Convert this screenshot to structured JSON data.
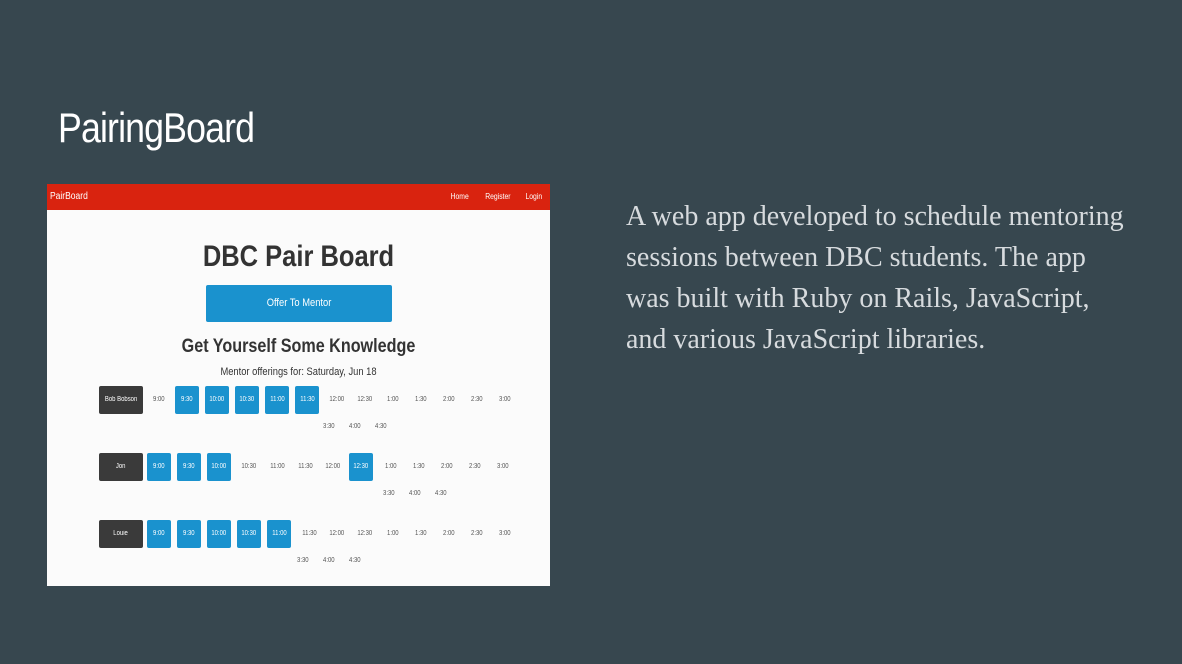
{
  "slide": {
    "title": "PairingBoard",
    "description": "A web app developed to schedule mentoring sessions between DBC students. The app was built with Ruby on Rails, JavaScript, and various JavaScript libraries."
  },
  "app": {
    "brand": "PairBoard",
    "nav": [
      "Home",
      "Register",
      "Login"
    ],
    "title": "DBC Pair Board",
    "offer_button": "Offer To Mentor",
    "subheading": "Get Yourself Some Knowledge",
    "date_line": "Mentor offerings for: Saturday, Jun 18",
    "mentors": [
      {
        "name": "Bob Bobson",
        "slots": [
          {
            "t": "9:00",
            "on": false
          },
          {
            "t": "9:30",
            "on": true
          },
          {
            "t": "10:00",
            "on": true
          },
          {
            "t": "10:30",
            "on": true
          },
          {
            "t": "11:00",
            "on": true
          },
          {
            "t": "11:30",
            "on": true
          },
          {
            "t": "12:00",
            "on": false
          },
          {
            "t": "12:30",
            "on": false
          },
          {
            "t": "1:00",
            "on": false
          },
          {
            "t": "1:30",
            "on": false
          },
          {
            "t": "2:00",
            "on": false
          },
          {
            "t": "2:30",
            "on": false
          },
          {
            "t": "3:00",
            "on": false
          },
          {
            "t": "3:30",
            "on": false
          },
          {
            "t": "4:00",
            "on": false
          },
          {
            "t": "4:30",
            "on": false
          }
        ]
      },
      {
        "name": "Jon",
        "slots": [
          {
            "t": "9:00",
            "on": true
          },
          {
            "t": "9:30",
            "on": true
          },
          {
            "t": "10:00",
            "on": true
          },
          {
            "t": "10:30",
            "on": false
          },
          {
            "t": "11:00",
            "on": false
          },
          {
            "t": "11:30",
            "on": false
          },
          {
            "t": "12:00",
            "on": false
          },
          {
            "t": "12:30",
            "on": true
          },
          {
            "t": "1:00",
            "on": false
          },
          {
            "t": "1:30",
            "on": false
          },
          {
            "t": "2:00",
            "on": false
          },
          {
            "t": "2:30",
            "on": false
          },
          {
            "t": "3:00",
            "on": false
          },
          {
            "t": "3:30",
            "on": false
          },
          {
            "t": "4:00",
            "on": false
          },
          {
            "t": "4:30",
            "on": false
          }
        ]
      },
      {
        "name": "Louie",
        "slots": [
          {
            "t": "9:00",
            "on": true
          },
          {
            "t": "9:30",
            "on": true
          },
          {
            "t": "10:00",
            "on": true
          },
          {
            "t": "10:30",
            "on": true
          },
          {
            "t": "11:00",
            "on": true
          },
          {
            "t": "11:30",
            "on": false
          },
          {
            "t": "12:00",
            "on": false
          },
          {
            "t": "12:30",
            "on": false
          },
          {
            "t": "1:00",
            "on": false
          },
          {
            "t": "1:30",
            "on": false
          },
          {
            "t": "2:00",
            "on": false
          },
          {
            "t": "2:30",
            "on": false
          },
          {
            "t": "3:00",
            "on": false
          },
          {
            "t": "3:30",
            "on": false
          },
          {
            "t": "4:00",
            "on": false
          },
          {
            "t": "4:30",
            "on": false
          }
        ]
      }
    ]
  },
  "colors": {
    "background": "#37474f",
    "navbar": "#d9230f",
    "slot_active": "#1a92ce",
    "name_button": "#3a3a3a"
  }
}
